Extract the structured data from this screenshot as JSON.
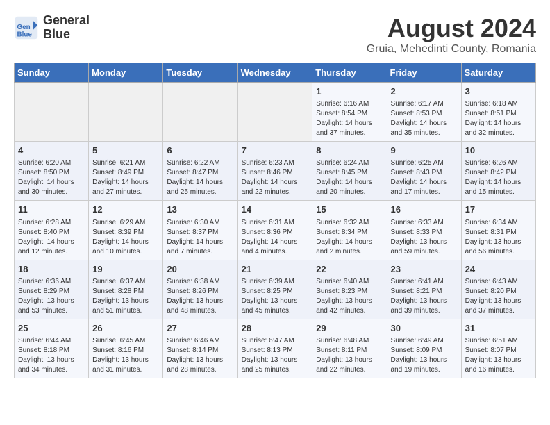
{
  "logo": {
    "line1": "General",
    "line2": "Blue"
  },
  "title": "August 2024",
  "subtitle": "Gruia, Mehedinti County, Romania",
  "days_of_week": [
    "Sunday",
    "Monday",
    "Tuesday",
    "Wednesday",
    "Thursday",
    "Friday",
    "Saturday"
  ],
  "weeks": [
    [
      {
        "day": "",
        "info": ""
      },
      {
        "day": "",
        "info": ""
      },
      {
        "day": "",
        "info": ""
      },
      {
        "day": "",
        "info": ""
      },
      {
        "day": "1",
        "info": "Sunrise: 6:16 AM\nSunset: 8:54 PM\nDaylight: 14 hours and 37 minutes."
      },
      {
        "day": "2",
        "info": "Sunrise: 6:17 AM\nSunset: 8:53 PM\nDaylight: 14 hours and 35 minutes."
      },
      {
        "day": "3",
        "info": "Sunrise: 6:18 AM\nSunset: 8:51 PM\nDaylight: 14 hours and 32 minutes."
      }
    ],
    [
      {
        "day": "4",
        "info": "Sunrise: 6:20 AM\nSunset: 8:50 PM\nDaylight: 14 hours and 30 minutes."
      },
      {
        "day": "5",
        "info": "Sunrise: 6:21 AM\nSunset: 8:49 PM\nDaylight: 14 hours and 27 minutes."
      },
      {
        "day": "6",
        "info": "Sunrise: 6:22 AM\nSunset: 8:47 PM\nDaylight: 14 hours and 25 minutes."
      },
      {
        "day": "7",
        "info": "Sunrise: 6:23 AM\nSunset: 8:46 PM\nDaylight: 14 hours and 22 minutes."
      },
      {
        "day": "8",
        "info": "Sunrise: 6:24 AM\nSunset: 8:45 PM\nDaylight: 14 hours and 20 minutes."
      },
      {
        "day": "9",
        "info": "Sunrise: 6:25 AM\nSunset: 8:43 PM\nDaylight: 14 hours and 17 minutes."
      },
      {
        "day": "10",
        "info": "Sunrise: 6:26 AM\nSunset: 8:42 PM\nDaylight: 14 hours and 15 minutes."
      }
    ],
    [
      {
        "day": "11",
        "info": "Sunrise: 6:28 AM\nSunset: 8:40 PM\nDaylight: 14 hours and 12 minutes."
      },
      {
        "day": "12",
        "info": "Sunrise: 6:29 AM\nSunset: 8:39 PM\nDaylight: 14 hours and 10 minutes."
      },
      {
        "day": "13",
        "info": "Sunrise: 6:30 AM\nSunset: 8:37 PM\nDaylight: 14 hours and 7 minutes."
      },
      {
        "day": "14",
        "info": "Sunrise: 6:31 AM\nSunset: 8:36 PM\nDaylight: 14 hours and 4 minutes."
      },
      {
        "day": "15",
        "info": "Sunrise: 6:32 AM\nSunset: 8:34 PM\nDaylight: 14 hours and 2 minutes."
      },
      {
        "day": "16",
        "info": "Sunrise: 6:33 AM\nSunset: 8:33 PM\nDaylight: 13 hours and 59 minutes."
      },
      {
        "day": "17",
        "info": "Sunrise: 6:34 AM\nSunset: 8:31 PM\nDaylight: 13 hours and 56 minutes."
      }
    ],
    [
      {
        "day": "18",
        "info": "Sunrise: 6:36 AM\nSunset: 8:29 PM\nDaylight: 13 hours and 53 minutes."
      },
      {
        "day": "19",
        "info": "Sunrise: 6:37 AM\nSunset: 8:28 PM\nDaylight: 13 hours and 51 minutes."
      },
      {
        "day": "20",
        "info": "Sunrise: 6:38 AM\nSunset: 8:26 PM\nDaylight: 13 hours and 48 minutes."
      },
      {
        "day": "21",
        "info": "Sunrise: 6:39 AM\nSunset: 8:25 PM\nDaylight: 13 hours and 45 minutes."
      },
      {
        "day": "22",
        "info": "Sunrise: 6:40 AM\nSunset: 8:23 PM\nDaylight: 13 hours and 42 minutes."
      },
      {
        "day": "23",
        "info": "Sunrise: 6:41 AM\nSunset: 8:21 PM\nDaylight: 13 hours and 39 minutes."
      },
      {
        "day": "24",
        "info": "Sunrise: 6:43 AM\nSunset: 8:20 PM\nDaylight: 13 hours and 37 minutes."
      }
    ],
    [
      {
        "day": "25",
        "info": "Sunrise: 6:44 AM\nSunset: 8:18 PM\nDaylight: 13 hours and 34 minutes."
      },
      {
        "day": "26",
        "info": "Sunrise: 6:45 AM\nSunset: 8:16 PM\nDaylight: 13 hours and 31 minutes."
      },
      {
        "day": "27",
        "info": "Sunrise: 6:46 AM\nSunset: 8:14 PM\nDaylight: 13 hours and 28 minutes."
      },
      {
        "day": "28",
        "info": "Sunrise: 6:47 AM\nSunset: 8:13 PM\nDaylight: 13 hours and 25 minutes."
      },
      {
        "day": "29",
        "info": "Sunrise: 6:48 AM\nSunset: 8:11 PM\nDaylight: 13 hours and 22 minutes."
      },
      {
        "day": "30",
        "info": "Sunrise: 6:49 AM\nSunset: 8:09 PM\nDaylight: 13 hours and 19 minutes."
      },
      {
        "day": "31",
        "info": "Sunrise: 6:51 AM\nSunset: 8:07 PM\nDaylight: 13 hours and 16 minutes."
      }
    ]
  ]
}
